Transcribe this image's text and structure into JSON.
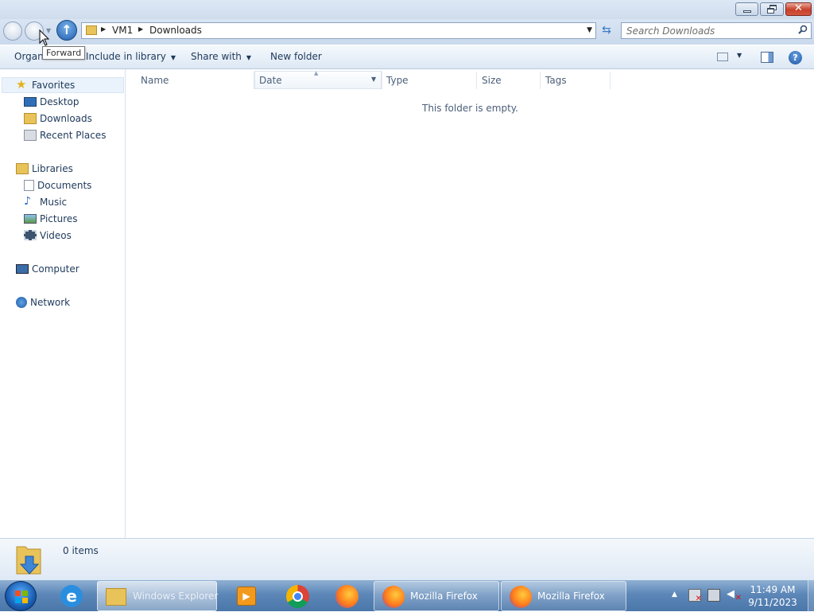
{
  "window": {
    "title": "Downloads"
  },
  "nav": {
    "breadcrumb": [
      "VM1",
      "Downloads"
    ],
    "search_placeholder": "Search Downloads",
    "tooltip": "Forward"
  },
  "toolbar": {
    "organize": "Organize",
    "include_in_library": "Include in library",
    "share_with": "Share with",
    "new_folder": "New folder"
  },
  "sidebar": {
    "favorites": {
      "label": "Favorites",
      "items": [
        {
          "label": "Desktop",
          "icon": "desktop-icon"
        },
        {
          "label": "Downloads",
          "icon": "downloads-folder-icon"
        },
        {
          "label": "Recent Places",
          "icon": "recent-places-icon"
        }
      ]
    },
    "libraries": {
      "label": "Libraries",
      "items": [
        {
          "label": "Documents",
          "icon": "documents-icon"
        },
        {
          "label": "Music",
          "icon": "music-icon"
        },
        {
          "label": "Pictures",
          "icon": "pictures-icon"
        },
        {
          "label": "Videos",
          "icon": "videos-icon"
        }
      ]
    },
    "computer": {
      "label": "Computer"
    },
    "network": {
      "label": "Network"
    }
  },
  "columns": [
    "Name",
    "Date",
    "Type",
    "Size",
    "Tags"
  ],
  "content": {
    "empty_message": "This folder is empty."
  },
  "details": {
    "count": "0 items"
  },
  "taskbar": {
    "windows": [
      {
        "label": "Windows Explorer",
        "icon": "explorer-icon"
      },
      {
        "label": "Mozilla Firefox",
        "icon": "firefox-icon"
      },
      {
        "label": "Mozilla Firefox",
        "icon": "firefox-icon"
      }
    ],
    "pinned": [
      "internet-explorer-icon",
      "media-player-icon",
      "chrome-icon",
      "firefox-icon"
    ],
    "clock": {
      "time": "11:49 AM",
      "date": "9/11/2023"
    }
  },
  "colors": {
    "accent": "#1e395b",
    "taskbar": "#5c87b8",
    "folder": "#e8c35a"
  }
}
